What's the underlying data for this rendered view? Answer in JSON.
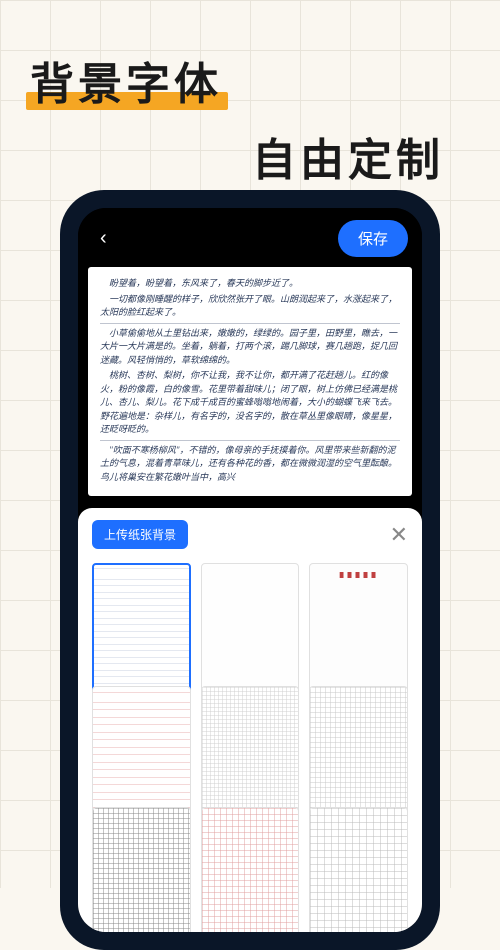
{
  "headline": {
    "line1": "背景字体",
    "line2": "自由定制"
  },
  "topbar": {
    "back_icon": "‹",
    "save_label": "保存"
  },
  "document": {
    "lines": [
      "盼望着，盼望着，东风来了，春天的脚步近了。",
      "一切都像刚睡醒的样子，欣欣然张开了眼。山朗润起来了，水涨起来了，太阳的脸红起来了。",
      "小草偷偷地从土里钻出来，嫩嫩的，绿绿的。园子里，田野里，瞧去，一大片一大片满是的。坐着，躺着，打两个滚，踢几脚球，赛几趟跑，捉几回迷藏。风轻悄悄的，草软绵绵的。",
      "桃树、杏树、梨树，你不让我，我不让你，都开满了花赶趟儿。红的像火，粉的像霞，白的像雪。花里带着甜味儿；闭了眼，树上仿佛已经满是桃儿、杏儿、梨儿。花下成千成百的蜜蜂嗡嗡地闹着，大小的蝴蝶飞来飞去。野花遍地是：杂样儿，有名字的，没名字的，散在草丛里像眼睛，像星星，还眨呀眨的。",
      "\"吹面不寒杨柳风\"，不错的，像母亲的手抚摸着你。风里带来些新翻的泥土的气息，混着青草味儿，还有各种花的香，都在微微润湿的空气里酝酿。鸟儿将巢安在繁花嫩叶当中，高兴"
    ]
  },
  "sheet": {
    "upload_label": "上传纸张背景",
    "close_icon": "✕",
    "options": [
      {
        "name": "lined-blue",
        "class": "paper-lined-blue",
        "selected": true
      },
      {
        "name": "blank",
        "class": "paper-blank",
        "selected": false
      },
      {
        "name": "letterhead",
        "class": "paper-letterhead",
        "selected": false
      },
      {
        "name": "lined-red",
        "class": "paper-lined-red",
        "selected": false
      },
      {
        "name": "grid-small",
        "class": "paper-grid-small",
        "selected": false
      },
      {
        "name": "grid-med",
        "class": "paper-grid-med",
        "selected": false
      },
      {
        "name": "grid-dark",
        "class": "paper-grid-dark",
        "selected": false
      },
      {
        "name": "grid-red",
        "class": "paper-grid-red",
        "selected": false
      },
      {
        "name": "grid-wide",
        "class": "paper-grid-wide",
        "selected": false
      }
    ]
  }
}
